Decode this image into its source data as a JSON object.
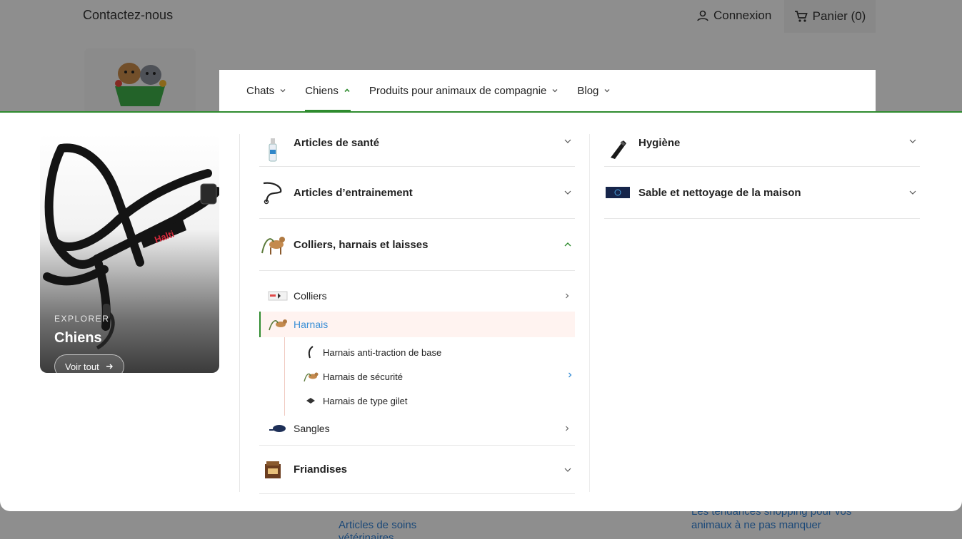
{
  "topbar": {
    "contact": "Contactez-nous",
    "login": "Connexion",
    "cart": "Panier (0)"
  },
  "footer_bg": {
    "link_a": "Articles de soins vétérinaires",
    "link_b": "Les tendances shopping pour vos animaux à ne pas manquer"
  },
  "nav": {
    "items": [
      {
        "label": "Chats"
      },
      {
        "label": "Chiens"
      },
      {
        "label": "Produits pour animaux de compagnie"
      },
      {
        "label": "Blog"
      }
    ]
  },
  "promo": {
    "eyebrow": "EXPLORER",
    "title": "Chiens",
    "button": "Voir tout",
    "halter_text": "Halti"
  },
  "col1": {
    "cat_health": "Articles de santé",
    "cat_training": "Articles d’entrainement",
    "cat_collars": "Colliers, harnais et laisses",
    "sub_colliers": "Colliers",
    "sub_harnais": "Harnais",
    "subsub": [
      "Harnais anti-traction de base",
      "Harnais de sécurité",
      "Harnais de type gilet"
    ],
    "sub_sangles": "Sangles",
    "cat_treats": "Friandises"
  },
  "col2": {
    "cat_hygiene": "Hygiène",
    "cat_sand": "Sable et nettoyage de la maison"
  },
  "colors": {
    "accent_green": "#2e8b2e",
    "link_blue": "#3b8fd6",
    "highlight_bg": "#fff3f0"
  }
}
